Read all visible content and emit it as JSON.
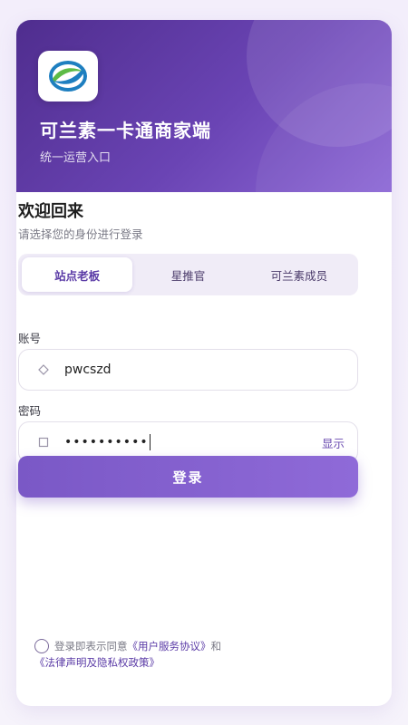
{
  "header": {
    "title": "可兰素一卡通商家端",
    "subtitle": "统一运营入口",
    "logo_icon": "leaf-swirl-logo"
  },
  "welcome": {
    "title": "欢迎回来",
    "subtitle": "请选择您的身份进行登录"
  },
  "tabs": [
    {
      "label": "站点老板",
      "active": true
    },
    {
      "label": "星推官",
      "active": false
    },
    {
      "label": "可兰素成员",
      "active": false
    }
  ],
  "account": {
    "label": "账号",
    "value": "pwcszd",
    "icon": "diamond-icon"
  },
  "password": {
    "label": "密码",
    "masked": "••••••••••",
    "icon": "square-icon",
    "show_label": "显示"
  },
  "login_label": "登录",
  "agreement": {
    "prefix": "登录即表示同意",
    "link1": "《用户服务协议》",
    "and": "和",
    "link2": "《法律声明及隐私权政策》"
  },
  "colors": {
    "brand": "#6a44b4",
    "accent": "#8f6ad8"
  }
}
